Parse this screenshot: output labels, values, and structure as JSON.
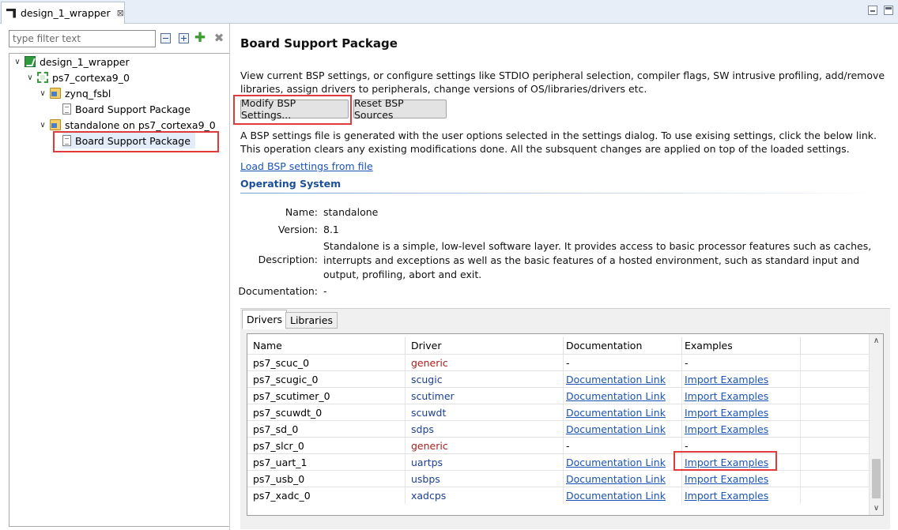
{
  "editor": {
    "tab_title": "design_1_wrapper",
    "close_glyph": "⊠"
  },
  "sidebar": {
    "filter_placeholder": "type filter text",
    "tree": [
      {
        "label": "design_1_wrapper",
        "icon": "project-icon",
        "twisty": "expanded"
      },
      {
        "label": "ps7_cortexa9_0",
        "icon": "processor-icon",
        "twisty": "expanded"
      },
      {
        "label": "zynq_fsbl",
        "icon": "folder-icon",
        "twisty": "expanded"
      },
      {
        "label": "Board Support Package",
        "icon": "document-icon",
        "twisty": "none"
      },
      {
        "label": "standalone on ps7_cortexa9_0",
        "icon": "folder-icon",
        "twisty": "expanded"
      },
      {
        "label": "Board Support Package",
        "icon": "document-icon",
        "twisty": "none",
        "selected": true
      }
    ]
  },
  "main": {
    "title": "Board Support Package",
    "intro": "View current BSP settings, or configure settings like STDIO peripheral selection, compiler flags, SW intrusive profiling, add/remove libraries, assign drivers to peripherals, change versions of OS/libraries/drivers etc.",
    "modify_button": "Modify BSP Settings...",
    "reset_button": "Reset BSP Sources",
    "note": "A BSP settings file is generated with the user options selected in the settings dialog. To use exising settings, click the below link. This operation clears any existing modifications done. All the subsquent changes are applied on top of the loaded settings.",
    "load_link": "Load BSP settings from file",
    "os_section": {
      "heading": "Operating System",
      "name_label": "Name:",
      "name_value": "standalone",
      "version_label": "Version:",
      "version_value": "8.1",
      "description_label": "Description:",
      "description_value": "Standalone is a simple, low-level software layer. It provides access to basic processor features such as caches, interrupts and exceptions as well as the basic features of a hosted environment, such as standard input and output, profiling, abort and exit.",
      "documentation_label": "Documentation:",
      "documentation_value": "-"
    },
    "tabs": [
      {
        "label": "Drivers",
        "active": true
      },
      {
        "label": "Libraries",
        "active": false
      }
    ],
    "table": {
      "columns": [
        "Name",
        "Driver",
        "Documentation",
        "Examples"
      ],
      "rows": [
        {
          "name": "ps7_scuc_0",
          "driver": "generic",
          "doc": "-",
          "examples": "-"
        },
        {
          "name": "ps7_scugic_0",
          "driver": "scugic",
          "doc": "Documentation Link",
          "examples": "Import Examples"
        },
        {
          "name": "ps7_scutimer_0",
          "driver": "scutimer",
          "doc": "Documentation Link",
          "examples": "Import Examples"
        },
        {
          "name": "ps7_scuwdt_0",
          "driver": "scuwdt",
          "doc": "Documentation Link",
          "examples": "Import Examples"
        },
        {
          "name": "ps7_sd_0",
          "driver": "sdps",
          "doc": "Documentation Link",
          "examples": "Import Examples"
        },
        {
          "name": "ps7_slcr_0",
          "driver": "generic",
          "doc": "-",
          "examples": "-"
        },
        {
          "name": "ps7_uart_1",
          "driver": "uartps",
          "doc": "Documentation Link",
          "examples": "Import Examples"
        },
        {
          "name": "ps7_usb_0",
          "driver": "usbps",
          "doc": "Documentation Link",
          "examples": "Import Examples"
        },
        {
          "name": "ps7_xadc_0",
          "driver": "xadcps",
          "doc": "Documentation Link",
          "examples": "Import Examples"
        }
      ]
    }
  },
  "colors": {
    "link": "#1a54b7",
    "generic_driver": "#a8211f",
    "driver": "#1c3f95",
    "highlight_box": "#e03a3a",
    "section_heading": "#1a4f9a"
  }
}
